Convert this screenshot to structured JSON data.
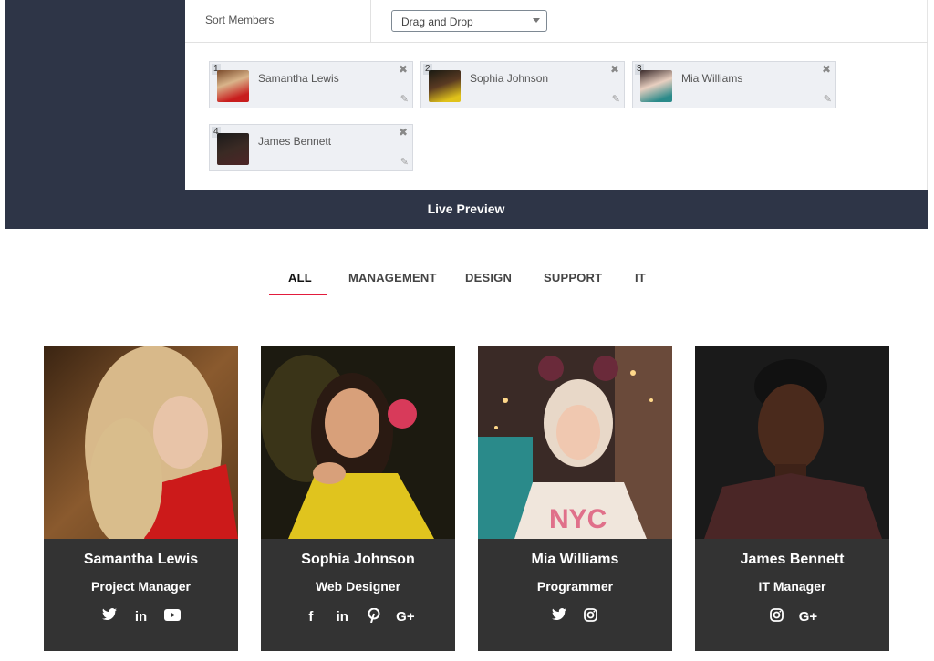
{
  "sort": {
    "label": "Sort Members",
    "selected": "Drag and Drop"
  },
  "members": [
    {
      "num": "1",
      "name": "Samantha Lewis"
    },
    {
      "num": "2",
      "name": "Sophia Johnson"
    },
    {
      "num": "3",
      "name": "Mia Williams"
    },
    {
      "num": "4",
      "name": "James Bennett"
    }
  ],
  "banner": {
    "title": "Live Preview"
  },
  "tabs": [
    {
      "label": "ALL",
      "active": true
    },
    {
      "label": "MANAGEMENT"
    },
    {
      "label": "DESIGN"
    },
    {
      "label": "SUPPORT"
    },
    {
      "label": "IT"
    }
  ],
  "cards": [
    {
      "name": "Samantha Lewis",
      "role": "Project Manager",
      "socials": [
        "twitter-icon",
        "linkedin-icon",
        "youtube-icon"
      ]
    },
    {
      "name": "Sophia Johnson",
      "role": "Web Designer",
      "socials": [
        "facebook-icon",
        "linkedin-icon",
        "pinterest-icon",
        "google-plus-icon"
      ]
    },
    {
      "name": "Mia Williams",
      "role": "Programmer",
      "socials": [
        "twitter-icon",
        "instagram-icon"
      ]
    },
    {
      "name": "James Bennett",
      "role": "IT Manager",
      "socials": [
        "instagram-icon",
        "google-plus-icon"
      ]
    }
  ],
  "colors": {
    "dark_panel": "#2e3547",
    "card_bg": "#333333",
    "accent": "#e21b3c"
  }
}
